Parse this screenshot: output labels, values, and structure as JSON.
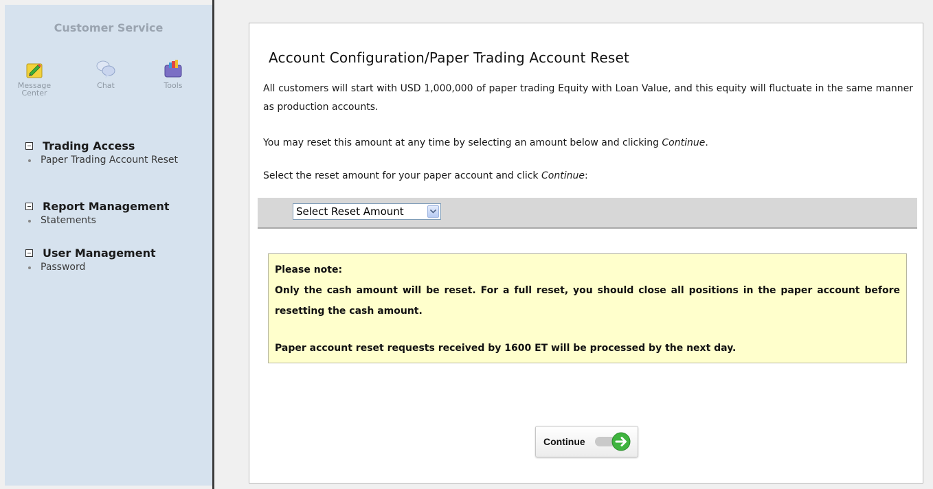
{
  "sidebar": {
    "title": "Customer Service",
    "tools": [
      {
        "label": "Message\nCenter",
        "icon": "message-center-icon"
      },
      {
        "label": "Chat",
        "icon": "chat-icon"
      },
      {
        "label": "Tools",
        "icon": "tools-icon"
      }
    ],
    "sections": [
      {
        "heading": "Trading Access",
        "links": [
          "Paper Trading Account Reset"
        ]
      },
      {
        "heading": "Report Management",
        "links": [
          "Statements"
        ]
      },
      {
        "heading": "User Management",
        "links": [
          "Password"
        ]
      }
    ]
  },
  "main": {
    "title": "Account Configuration/Paper Trading Account Reset",
    "paragraph1": "All customers will start with USD 1,000,000 of paper trading Equity with Loan Value, and this equity will fluctuate in the same manner as production accounts.",
    "paragraph2_text": "You may reset this amount at any time by selecting an amount below and clicking ",
    "paragraph2_em": "Continue",
    "paragraph2_end": ".",
    "paragraph3_text": "Select the reset amount for your paper account and click ",
    "paragraph3_em": "Continue",
    "paragraph3_end": ":",
    "select": {
      "selected": "Select Reset Amount"
    },
    "note": {
      "heading": "Please note:",
      "line1": "Only the cash amount will be reset. For a full reset, you should close all positions in the paper account before resetting the cash amount.",
      "line2": "Paper account reset requests received by 1600 ET will be processed by the next day."
    },
    "continue_label": "Continue"
  },
  "colors": {
    "sidebar_bg": "#d6e2ee",
    "note_bg": "#ffffcc",
    "select_bar_bg": "#d7d7d7",
    "continue_arrow": "#3fb43f"
  }
}
